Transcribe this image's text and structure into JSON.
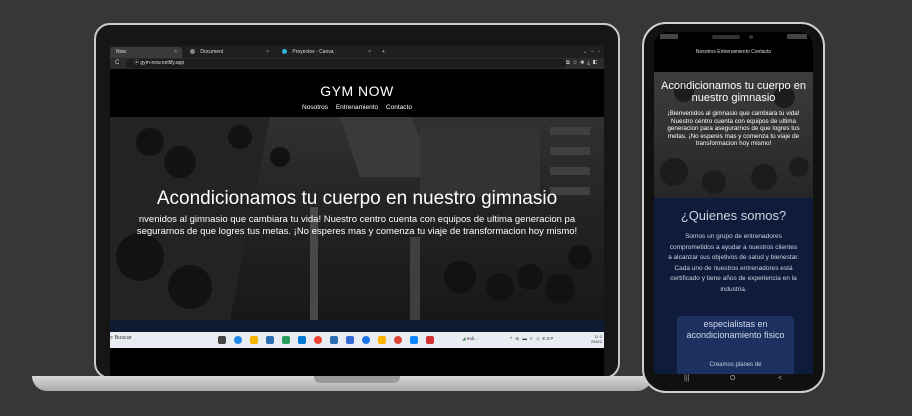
{
  "browser": {
    "tabs": [
      {
        "label": "Now",
        "close": "×"
      },
      {
        "label": "Document",
        "close": "×"
      },
      {
        "label": "Proyectos - Canva",
        "close": "×"
      }
    ],
    "new_tab": "+",
    "url": "gym-now.netlify.app",
    "reload": "C"
  },
  "site": {
    "brand": "GYM NOW",
    "nav": [
      "Nosotros",
      "Entrenamiento",
      "Contacto"
    ],
    "hero": {
      "title": "Acondicionamos tu cuerpo en nuestro gimnasio",
      "text_line1": "nvenidos al gimnasio que cambiara tu vida! Nuestro centro cuenta con equipos de ultima generacion pa",
      "text_line2": "segurarnos de que logres tus metas. ¡No esperes mas y comenza tu viaje de transformacion hoy mismo!"
    }
  },
  "taskbar": {
    "search": "Buscar",
    "tray_label": "Indi...",
    "lang": "ESP",
    "time": "11:2",
    "date": "25/8/2"
  },
  "mobile": {
    "nav": [
      "Nosotros",
      "Entrenamiento",
      "Contacto"
    ],
    "hero_title": "Acondicionamos tu cuerpo en nuestro gimnasio",
    "hero_text": "¡Bienvenidos al gimnasio que cambiara tu vida! Nuestro centro cuenta con equipos de ultima generacion para asegurarnos de que logres tus metas. ¡No esperes mas y comenza tu viaje de transformacion hoy mismo!",
    "about_title": "¿Quienes somos?",
    "about_text": "Somos un grupo de entrenadores comprometidos a ayudar a nuestros clientes a alcanzar sus objetivos de salud y bienestar. Cada uno de nuestros entrenadores está certificado y tiene años de experiencia en la industria.",
    "card_title": "especialistas en acondicionamiento fisico",
    "card_sub": "Creamos planes de",
    "nav_buttons": [
      "|||",
      "O",
      "<"
    ]
  },
  "colors": {
    "desktop_bg": "#373737",
    "navy": "#0e1b3a",
    "card": "#1d3160"
  }
}
